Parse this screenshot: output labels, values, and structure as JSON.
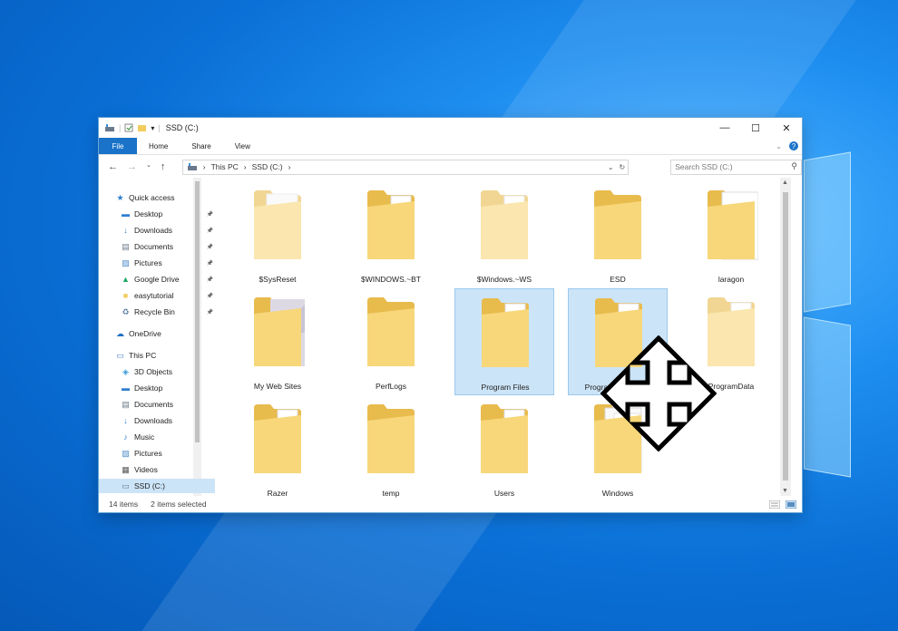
{
  "window": {
    "title": "SSD (C:)",
    "minimize": "—",
    "maximize": "☐",
    "close": "✕"
  },
  "ribbon": {
    "tabs": [
      "File",
      "Home",
      "Share",
      "View"
    ],
    "expand_glyph": "⌄",
    "help_glyph": "?"
  },
  "address": {
    "breadcrumb": [
      "This PC",
      "SSD (C:)"
    ],
    "separator": "›",
    "dropdown_glyph": "⌄",
    "refresh_glyph": "↻"
  },
  "search": {
    "placeholder": "Search SSD (C:)"
  },
  "nav": {
    "quick_access": "Quick access",
    "quick_items": [
      {
        "label": "Desktop",
        "icon": "desktop-icon",
        "pinned": true
      },
      {
        "label": "Downloads",
        "icon": "download-arrow-icon",
        "pinned": true
      },
      {
        "label": "Documents",
        "icon": "documents-icon",
        "pinned": true
      },
      {
        "label": "Pictures",
        "icon": "pictures-icon",
        "pinned": true
      },
      {
        "label": "Google Drive",
        "icon": "google-drive-icon",
        "pinned": true
      },
      {
        "label": "easytutorial",
        "icon": "folder-icon",
        "pinned": true
      },
      {
        "label": "Recycle Bin",
        "icon": "recycle-bin-icon",
        "pinned": true
      }
    ],
    "onedrive": "OneDrive",
    "this_pc": "This PC",
    "pc_items": [
      {
        "label": "3D Objects",
        "icon": "3d-objects-icon"
      },
      {
        "label": "Desktop",
        "icon": "desktop-icon"
      },
      {
        "label": "Documents",
        "icon": "documents-icon"
      },
      {
        "label": "Downloads",
        "icon": "download-arrow-icon"
      },
      {
        "label": "Music",
        "icon": "music-icon"
      },
      {
        "label": "Pictures",
        "icon": "pictures-icon"
      },
      {
        "label": "Videos",
        "icon": "videos-icon"
      },
      {
        "label": "SSD (C:)",
        "icon": "drive-icon",
        "selected": true
      }
    ]
  },
  "folders": [
    {
      "name": "$SysReset",
      "variant": "faded-doc",
      "selected": false
    },
    {
      "name": "$WINDOWS.~BT",
      "variant": "docs",
      "selected": false
    },
    {
      "name": "$Windows.~WS",
      "variant": "faded-docs",
      "selected": false
    },
    {
      "name": "ESD",
      "variant": "plain",
      "selected": false
    },
    {
      "name": "laragon",
      "variant": "laragon",
      "selected": false
    },
    {
      "name": "My Web Sites",
      "variant": "web",
      "selected": false
    },
    {
      "name": "PerfLogs",
      "variant": "plain",
      "selected": false
    },
    {
      "name": "Program Files",
      "variant": "docs",
      "selected": true
    },
    {
      "name": "Program Files (x86)",
      "variant": "docs",
      "selected": true
    },
    {
      "name": "ProgramData",
      "variant": "faded-docs",
      "selected": false
    },
    {
      "name": "Razer",
      "variant": "docs",
      "selected": false
    },
    {
      "name": "temp",
      "variant": "plain",
      "selected": false
    },
    {
      "name": "Users",
      "variant": "docs",
      "selected": false
    },
    {
      "name": "Windows",
      "variant": "white-docs",
      "selected": false
    }
  ],
  "status": {
    "count": "14 items",
    "selected": "2 items selected"
  },
  "colors": {
    "accent": "#1a73c9",
    "selection": "#cce4f7",
    "folder": "#f7d77a",
    "folder_dark": "#e8bb4d"
  },
  "cursor": {
    "icon": "move-cursor-icon"
  }
}
